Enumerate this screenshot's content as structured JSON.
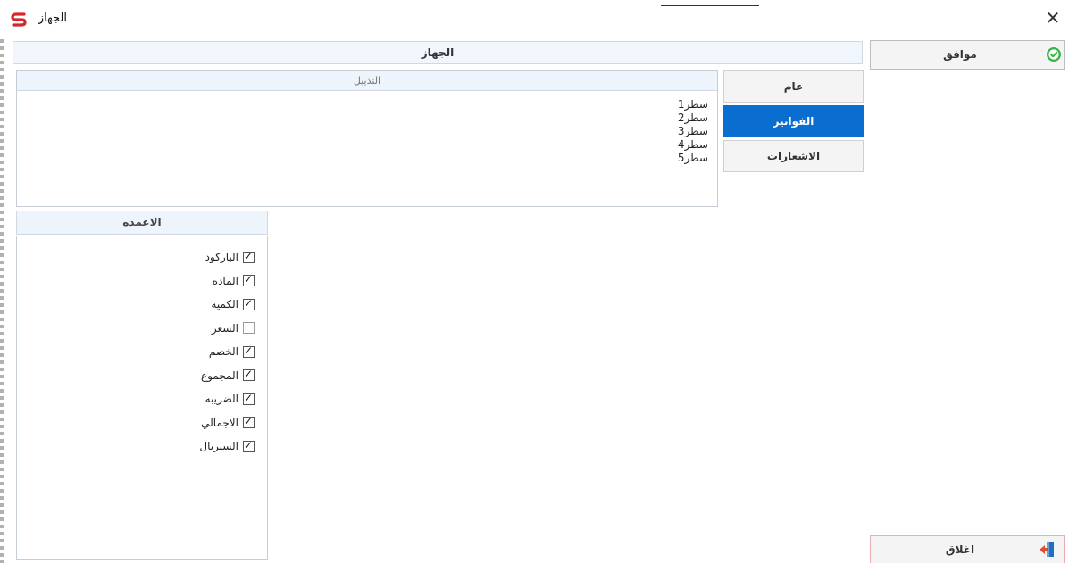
{
  "window": {
    "title": "الجهاز",
    "close_glyph": "✕"
  },
  "panel": {
    "header": "الجهاز"
  },
  "footer": {
    "header": "التذييل",
    "lines": [
      "سطر1",
      "سطر2",
      "سطر3",
      "سطر4",
      "سطر5"
    ]
  },
  "tabs": {
    "general": "عام",
    "invoices": "الفواتير",
    "notices": "الاشعارات",
    "active": "invoices"
  },
  "columns": {
    "header": "الاعمده",
    "items": [
      {
        "label": "الباركود",
        "checked": true
      },
      {
        "label": "الماده",
        "checked": true
      },
      {
        "label": "الكميه",
        "checked": true
      },
      {
        "label": "السعر",
        "checked": false
      },
      {
        "label": "الخصم",
        "checked": true
      },
      {
        "label": "المجموع",
        "checked": true
      },
      {
        "label": "الضريبه",
        "checked": true
      },
      {
        "label": "الاجمالي",
        "checked": true
      },
      {
        "label": "السيريال",
        "checked": true
      }
    ]
  },
  "buttons": {
    "ok_label": "موافق",
    "close_label": "اغلاق"
  },
  "icons": {
    "logo": "app-logo-icon",
    "ok": "check-circle-icon",
    "exit": "exit-door-icon"
  },
  "colors": {
    "accent": "#0a6ed1",
    "ok_green": "#3bb54a",
    "logo_red": "#d9262c"
  }
}
